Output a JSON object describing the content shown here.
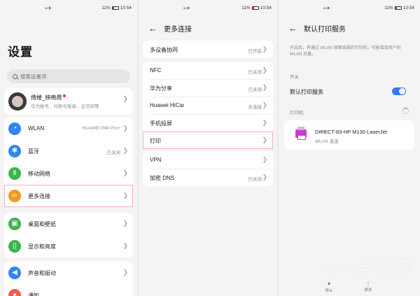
{
  "status": {
    "left_icons": "≈✈",
    "battery": "11%",
    "time": "10:54"
  },
  "settings": {
    "title": "设置",
    "search": {
      "placeholder": "搜索设置项"
    },
    "profile": {
      "name": "倚楼_映晚霞",
      "sub": "华为帐号、付款与账单、云空间等"
    },
    "items": [
      {
        "label": "WLAN",
        "value": "HUAWEI P40 Pro+",
        "icon": "wifi-icon",
        "color": "#2f86f5",
        "glyph": "◔"
      },
      {
        "label": "蓝牙",
        "value": "已关闭",
        "icon": "bluetooth-icon",
        "color": "#2f86f5",
        "glyph": "✱"
      },
      {
        "label": "移动网络",
        "value": "",
        "icon": "signal-icon",
        "color": "#3bb54a",
        "glyph": "Ⅱ"
      },
      {
        "label": "更多连接",
        "value": "",
        "icon": "link-icon",
        "color": "#f29a1d",
        "glyph": "∞"
      },
      {
        "label": "桌面和壁纸",
        "value": "",
        "icon": "wallpaper-icon",
        "color": "#3bb54a",
        "glyph": "▣"
      },
      {
        "label": "显示和亮度",
        "value": "",
        "icon": "display-icon",
        "color": "#3bb54a",
        "glyph": "▯"
      },
      {
        "label": "声音和振动",
        "value": "",
        "icon": "sound-icon",
        "color": "#2f86f5",
        "glyph": "◀"
      },
      {
        "label": "通知",
        "value": "",
        "icon": "notification-icon",
        "color": "#f25b4b",
        "glyph": "●"
      }
    ]
  },
  "more": {
    "title": "更多连接",
    "items": [
      {
        "label": "多设备协同",
        "value": "已开启"
      },
      {
        "label": "NFC",
        "value": "已关闭"
      },
      {
        "label": "华为分享",
        "value": "已关闭"
      },
      {
        "label": "Huawei HiCar",
        "value": "未连接"
      },
      {
        "label": "手机投屏",
        "value": ""
      },
      {
        "label": "打印",
        "value": ""
      },
      {
        "label": "VPN",
        "value": ""
      },
      {
        "label": "加密 DNS",
        "value": "已关闭"
      }
    ]
  },
  "print": {
    "title": "默认打印服务",
    "desc": "开启后，将通过 WLAN 搜索周围的打印机，可能增加用户的 WLAN 流量。",
    "switch_section": "开关",
    "switch_label": "默认打印服务",
    "switch_on": true,
    "printer_section": "打印机",
    "printer": {
      "name": "DIRECT-83-HP M130 LaserJet",
      "sub": "WLAN 直连"
    },
    "bottom": [
      {
        "label": "停止",
        "icon": "stop-icon",
        "glyph": "⏸"
      },
      {
        "label": "更多",
        "icon": "more-icon",
        "glyph": "⋮"
      }
    ]
  },
  "watermark": "MN手机网"
}
